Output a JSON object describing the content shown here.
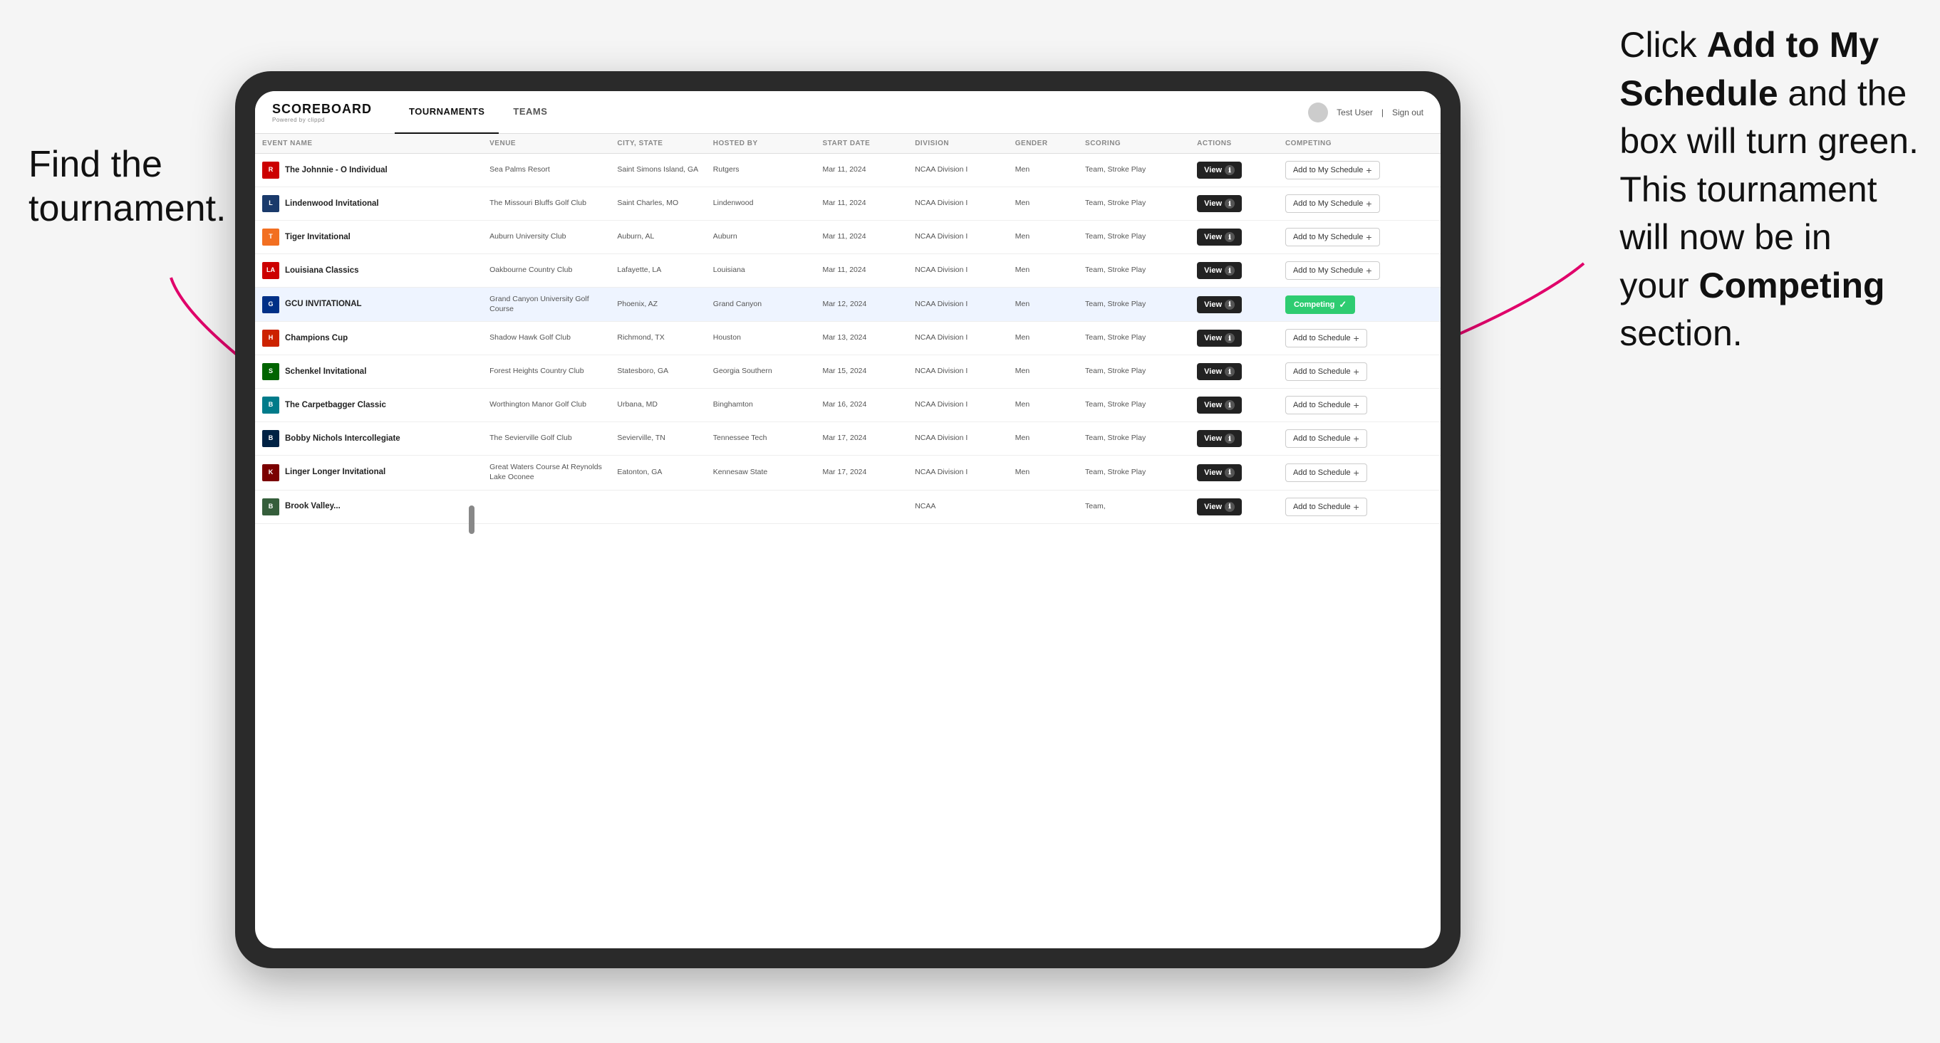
{
  "annotations": {
    "left": "Find the\ntournament.",
    "right_part1": "Click ",
    "right_bold1": "Add to My\nSchedule",
    "right_part2": " and the\nbox will turn green.\nThis tournament\nwill now be in\nyour ",
    "right_bold2": "Competing",
    "right_part3": "\nsection."
  },
  "nav": {
    "logo": "SCOREBOARD",
    "logo_sub": "Powered by clippd",
    "tabs": [
      "TOURNAMENTS",
      "TEAMS"
    ],
    "active_tab": "TOURNAMENTS",
    "user": "Test User",
    "sign_out": "Sign out"
  },
  "table": {
    "columns": [
      "EVENT NAME",
      "VENUE",
      "CITY, STATE",
      "HOSTED BY",
      "START DATE",
      "DIVISION",
      "GENDER",
      "SCORING",
      "ACTIONS",
      "COMPETING"
    ],
    "rows": [
      {
        "logo_color": "red",
        "logo_letter": "R",
        "event_name": "The Johnnie - O Individual",
        "venue": "Sea Palms Resort",
        "city_state": "Saint Simons Island, GA",
        "hosted_by": "Rutgers",
        "start_date": "Mar 11, 2024",
        "division": "NCAA Division I",
        "gender": "Men",
        "scoring": "Team, Stroke Play",
        "action": "View",
        "competing": "Add to My Schedule",
        "is_competing": false,
        "highlighted": false
      },
      {
        "logo_color": "blue-dark",
        "logo_letter": "L",
        "event_name": "Lindenwood Invitational",
        "venue": "The Missouri Bluffs Golf Club",
        "city_state": "Saint Charles, MO",
        "hosted_by": "Lindenwood",
        "start_date": "Mar 11, 2024",
        "division": "NCAA Division I",
        "gender": "Men",
        "scoring": "Team, Stroke Play",
        "action": "View",
        "competing": "Add to My Schedule",
        "is_competing": false,
        "highlighted": false
      },
      {
        "logo_color": "orange",
        "logo_letter": "T",
        "event_name": "Tiger Invitational",
        "venue": "Auburn University Club",
        "city_state": "Auburn, AL",
        "hosted_by": "Auburn",
        "start_date": "Mar 11, 2024",
        "division": "NCAA Division I",
        "gender": "Men",
        "scoring": "Team, Stroke Play",
        "action": "View",
        "competing": "Add to My Schedule",
        "is_competing": false,
        "highlighted": false
      },
      {
        "logo_color": "red",
        "logo_letter": "LA",
        "event_name": "Louisiana Classics",
        "venue": "Oakbourne Country Club",
        "city_state": "Lafayette, LA",
        "hosted_by": "Louisiana",
        "start_date": "Mar 11, 2024",
        "division": "NCAA Division I",
        "gender": "Men",
        "scoring": "Team, Stroke Play",
        "action": "View",
        "competing": "Add to My Schedule",
        "is_competing": false,
        "highlighted": false
      },
      {
        "logo_color": "blue",
        "logo_letter": "G",
        "event_name": "GCU INVITATIONAL",
        "venue": "Grand Canyon University Golf Course",
        "city_state": "Phoenix, AZ",
        "hosted_by": "Grand Canyon",
        "start_date": "Mar 12, 2024",
        "division": "NCAA Division I",
        "gender": "Men",
        "scoring": "Team, Stroke Play",
        "action": "View",
        "competing": "Competing",
        "is_competing": true,
        "highlighted": true
      },
      {
        "logo_color": "red2",
        "logo_letter": "H",
        "event_name": "Champions Cup",
        "venue": "Shadow Hawk Golf Club",
        "city_state": "Richmond, TX",
        "hosted_by": "Houston",
        "start_date": "Mar 13, 2024",
        "division": "NCAA Division I",
        "gender": "Men",
        "scoring": "Team, Stroke Play",
        "action": "View",
        "competing": "Add to Schedule",
        "is_competing": false,
        "highlighted": false
      },
      {
        "logo_color": "green-dark",
        "logo_letter": "S",
        "event_name": "Schenkel Invitational",
        "venue": "Forest Heights Country Club",
        "city_state": "Statesboro, GA",
        "hosted_by": "Georgia Southern",
        "start_date": "Mar 15, 2024",
        "division": "NCAA Division I",
        "gender": "Men",
        "scoring": "Team, Stroke Play",
        "action": "View",
        "competing": "Add to Schedule",
        "is_competing": false,
        "highlighted": false
      },
      {
        "logo_color": "teal",
        "logo_letter": "B",
        "event_name": "The Carpetbagger Classic",
        "venue": "Worthington Manor Golf Club",
        "city_state": "Urbana, MD",
        "hosted_by": "Binghamton",
        "start_date": "Mar 16, 2024",
        "division": "NCAA Division I",
        "gender": "Men",
        "scoring": "Team, Stroke Play",
        "action": "View",
        "competing": "Add to Schedule",
        "is_competing": false,
        "highlighted": false
      },
      {
        "logo_color": "dark-blue",
        "logo_letter": "B",
        "event_name": "Bobby Nichols Intercollegiate",
        "venue": "The Sevierville Golf Club",
        "city_state": "Sevierville, TN",
        "hosted_by": "Tennessee Tech",
        "start_date": "Mar 17, 2024",
        "division": "NCAA Division I",
        "gender": "Men",
        "scoring": "Team, Stroke Play",
        "action": "View",
        "competing": "Add to Schedule",
        "is_competing": false,
        "highlighted": false
      },
      {
        "logo_color": "maroon",
        "logo_letter": "K",
        "event_name": "Linger Longer Invitational",
        "venue": "Great Waters Course At Reynolds Lake Oconee",
        "city_state": "Eatonton, GA",
        "hosted_by": "Kennesaw State",
        "start_date": "Mar 17, 2024",
        "division": "NCAA Division I",
        "gender": "Men",
        "scoring": "Team, Stroke Play",
        "action": "View",
        "competing": "Add to Schedule",
        "is_competing": false,
        "highlighted": false
      },
      {
        "logo_color": "forest",
        "logo_letter": "B",
        "event_name": "Brook Valley...",
        "venue": "",
        "city_state": "",
        "hosted_by": "",
        "start_date": "",
        "division": "NCAA",
        "gender": "",
        "scoring": "Team,",
        "action": "View",
        "competing": "Add to Schedule",
        "is_competing": false,
        "highlighted": false
      }
    ]
  }
}
